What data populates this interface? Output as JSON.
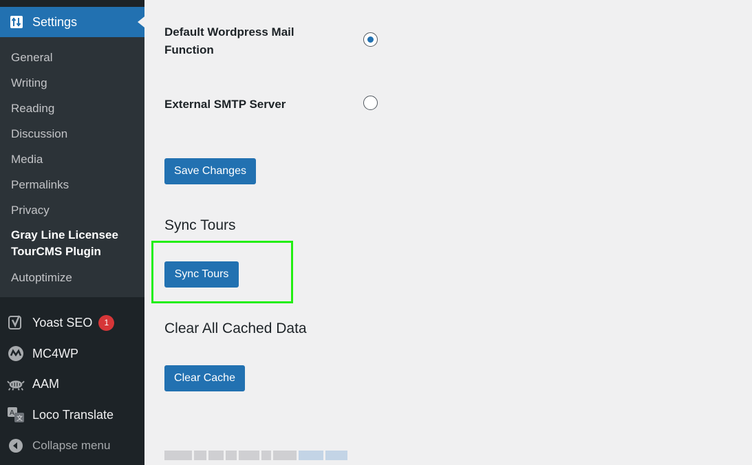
{
  "sidebar": {
    "settings_label": "Settings",
    "submenu": [
      "General",
      "Writing",
      "Reading",
      "Discussion",
      "Media",
      "Permalinks",
      "Privacy"
    ],
    "current_item": "Gray Line Licensee TourCMS Plugin",
    "after_current": "Autoptimize",
    "menu": [
      {
        "label": "Yoast SEO",
        "icon": "yoast-icon",
        "badge": "1"
      },
      {
        "label": "MC4WP",
        "icon": "mc4wp-icon"
      },
      {
        "label": "AAM",
        "icon": "aam-icon"
      },
      {
        "label": "Loco Translate",
        "icon": "loco-translate-icon"
      }
    ],
    "collapse_label": "Collapse menu"
  },
  "main": {
    "mail_options": [
      {
        "label": "Default Wordpress Mail Function",
        "checked": true
      },
      {
        "label": "External SMTP Server",
        "checked": false
      }
    ],
    "save_button": "Save Changes",
    "sync_title": "Sync Tours",
    "sync_button": "Sync Tours",
    "cache_title": "Clear All Cached Data",
    "cache_button": "Clear Cache"
  },
  "colors": {
    "accent": "#2271b1",
    "sidebar_bg": "#1d2327",
    "submenu_bg": "#2c3338",
    "highlight": "#22ee11",
    "badge": "#d63638"
  }
}
